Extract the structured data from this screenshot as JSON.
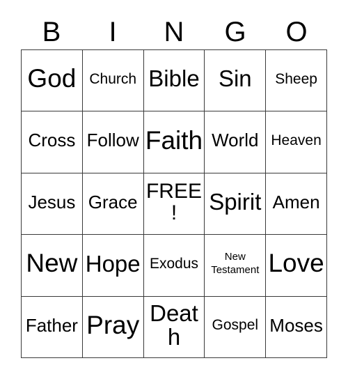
{
  "card": {
    "title": "BINGO",
    "header_letters": [
      "B",
      "I",
      "N",
      "G",
      "O"
    ],
    "grid": {
      "rows": 5,
      "columns": 5,
      "border_color": "#3a3a3a",
      "background_color": "#ffffff",
      "text_color": "#000000",
      "free_space": "FREE!",
      "cells": [
        [
          {
            "label": "God",
            "size": "xxl"
          },
          {
            "label": "Church",
            "size": "sm"
          },
          {
            "label": "Bible",
            "size": "xl"
          },
          {
            "label": "Sin",
            "size": "xl"
          },
          {
            "label": "Sheep",
            "size": "sm"
          }
        ],
        [
          {
            "label": "Cross",
            "size": "md"
          },
          {
            "label": "Follow",
            "size": "md"
          },
          {
            "label": "Faith",
            "size": "xxl"
          },
          {
            "label": "World",
            "size": "md"
          },
          {
            "label": "Heaven",
            "size": "sm"
          }
        ],
        [
          {
            "label": "Jesus",
            "size": "md"
          },
          {
            "label": "Grace",
            "size": "md"
          },
          {
            "label": "FREE!",
            "size": "lg"
          },
          {
            "label": "Spirit",
            "size": "xl"
          },
          {
            "label": "Amen",
            "size": "md"
          }
        ],
        [
          {
            "label": "New",
            "size": "xxl"
          },
          {
            "label": "Hope",
            "size": "xl"
          },
          {
            "label": "Exodus",
            "size": "sm"
          },
          {
            "label": "New Testament",
            "size": "xs"
          },
          {
            "label": "Love",
            "size": "xxl"
          }
        ],
        [
          {
            "label": "Father",
            "size": "md"
          },
          {
            "label": "Pray",
            "size": "xxl"
          },
          {
            "label": "Death",
            "size": "xl"
          },
          {
            "label": "Gospel",
            "size": "sm"
          },
          {
            "label": "Moses",
            "size": "md"
          }
        ]
      ]
    }
  }
}
